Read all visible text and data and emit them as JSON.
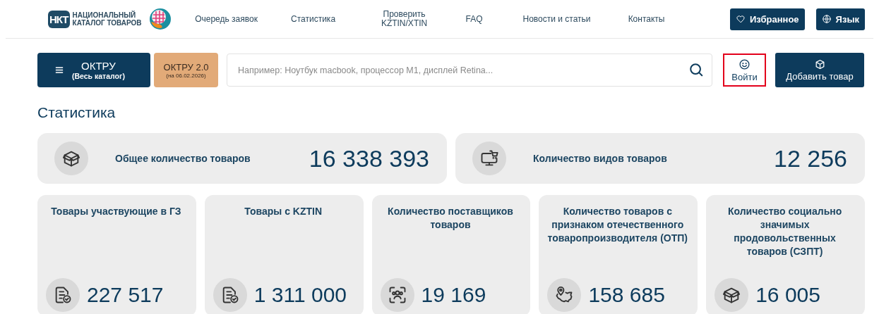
{
  "header": {
    "logo_lines": [
      "НАЦИОНАЛЬНЫЙ",
      "КАТАЛОГ ТОВАРОВ"
    ],
    "logo_mark": "НКТ",
    "links": [
      {
        "label": "Очередь заявок"
      },
      {
        "label": "Статистика"
      },
      {
        "label": "Проверить KZTIN/XTIN"
      },
      {
        "label": "FAQ"
      },
      {
        "label": "Новости и статьи"
      },
      {
        "label": "Контакты"
      }
    ],
    "buttons": [
      {
        "label": "Избранное",
        "kind": "heart"
      },
      {
        "label": "Язык",
        "kind": "globe"
      }
    ]
  },
  "toolbar": {
    "catalog_button": {
      "title": "ОКТРУ",
      "subtitle": "(Весь каталог)"
    },
    "version_button": {
      "title": "ОКТРУ 2.0",
      "subtitle": "(на 06.02.2026)"
    },
    "search": {
      "placeholder": "Например: Ноутбук macbook, процессор M1, дисплей Retina..."
    },
    "login_button": {
      "label": "Войти",
      "highlighted": true
    },
    "add_button": {
      "label": "Добавить товар"
    }
  },
  "page_title": "Статистика",
  "summary": [
    {
      "label": "Общее количество товаров",
      "value": "16 338 393",
      "kind": "box"
    },
    {
      "label": "Количество видов товаров",
      "value": "12 256",
      "kind": "monitor"
    }
  ],
  "cards": [
    {
      "label": "Товары участвующие в ГЗ",
      "value": "227 517",
      "kind": "document"
    },
    {
      "label": "Товары с KZTIN",
      "value": "1 311 000",
      "kind": "document"
    },
    {
      "label": "Количество поставщиков товаров",
      "value": "19 169",
      "kind": "suppliers"
    },
    {
      "label": "Количество товаров с признаком отечественного товаропроизводителя (ОТП)",
      "value": "158 685",
      "kind": "map"
    },
    {
      "label": "Количество социально значимых продовольственных товаров (СЗПТ)",
      "value": "16 005",
      "kind": "box"
    }
  ]
}
